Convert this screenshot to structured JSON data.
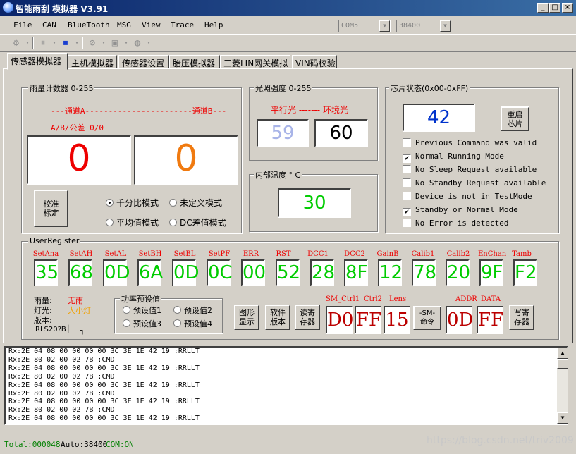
{
  "window": {
    "title": "智能雨刮 模拟器 V3.91",
    "minimize": "_",
    "maximize": "□",
    "close": "×"
  },
  "menu": [
    "File",
    "CAN",
    "BlueTooth",
    "MSG",
    "View",
    "Trace",
    "Help"
  ],
  "combo_port": "COM5",
  "combo_baud": "38400",
  "tabs": [
    "传感器模拟器",
    "主机模拟器",
    "传感器设置",
    "胎压模拟器",
    "三菱LIN网关模拟",
    "VIN码校验"
  ],
  "rain": {
    "title": "雨量计数器 0-255",
    "channels": "---通道A-----------------------通道B---",
    "ab_label": "A/B/公差  0/0",
    "value_a": "0",
    "value_b": "0",
    "calib_button": "校准\n标定",
    "modes": [
      {
        "label": "千分比模式",
        "checked": true
      },
      {
        "label": "未定义模式",
        "checked": false
      },
      {
        "label": "平均值模式",
        "checked": false
      },
      {
        "label": "DC差值模式",
        "checked": false
      }
    ]
  },
  "light": {
    "title": "光照强度 0-255",
    "subtitle": "平行光 ------- 环境光",
    "parallel": "59",
    "ambient": "60"
  },
  "temp": {
    "title": "内部温度 ° C",
    "value": "30"
  },
  "chip": {
    "title": "芯片状态(0x00-0xFF)",
    "value": "42",
    "restart_button": "重启\n芯片",
    "flags": [
      {
        "label": "Previous Command was valid",
        "checked": false
      },
      {
        "label": "Normal Running Mode",
        "checked": true
      },
      {
        "label": "No Sleep Request available",
        "checked": false
      },
      {
        "label": "No Standby Request available",
        "checked": false
      },
      {
        "label": "Device is not in TestMode",
        "checked": false
      },
      {
        "label": "Standby or Normal Mode",
        "checked": true
      },
      {
        "label": "No Error is detected",
        "checked": false
      }
    ]
  },
  "userregister": {
    "title": "UserRegister",
    "registers": [
      {
        "name": "SetAna",
        "value": "35"
      },
      {
        "name": "SetAH",
        "value": "68"
      },
      {
        "name": "SetAL",
        "value": "0D"
      },
      {
        "name": "SetBH",
        "value": "6A"
      },
      {
        "name": "SetBL",
        "value": "0D"
      },
      {
        "name": "SetPF",
        "value": "0C"
      },
      {
        "name": "ERR",
        "value": "00"
      },
      {
        "name": "RST",
        "value": "52"
      },
      {
        "name": "DCC1",
        "value": "28"
      },
      {
        "name": "DCC2",
        "value": "8F"
      },
      {
        "name": "GainB",
        "value": "12"
      },
      {
        "name": "Calib1",
        "value": "78"
      },
      {
        "name": "Calib2",
        "value": "20"
      },
      {
        "name": "EnChan",
        "value": "9F"
      },
      {
        "name": "Tamb",
        "value": "F2"
      }
    ],
    "rain_label": "雨量:",
    "rain_value": "无雨",
    "light_label": "灯光:",
    "light_value": "大小灯",
    "version_label": "版本:",
    "rls_label": "RLS20?B┤",
    "rls_extra": "┐",
    "power_title": "功率预设值",
    "presets": [
      "预设值1",
      "预设值2",
      "预设值3",
      "预设值4"
    ],
    "graph_button": "图形\n显示",
    "softver_button": "软件\n版本",
    "readreg_button": "读寄\n存器",
    "sm_ctrl1_label": "SM_Ctrl1",
    "sm_ctrl1": "D0",
    "ctrl2_label": "Ctrl2",
    "ctrl2": "FF",
    "lens_label": "Lens",
    "lens": "15",
    "sm_cmd_button": "-SM-\n命令",
    "addr_label": "ADDR",
    "addr": "0D",
    "data_label": "DATA",
    "data": "FF",
    "writereg_button": "写寄\n存器"
  },
  "log": [
    "Rx:2E 04 08 00 00 00 00 3C 3E 1E 42 19  :RRLLT",
    "Rx:2E 80 02 00 02 7B  :CMD",
    "Rx:2E 04 08 00 00 00 00 3C 3E 1E 42 19  :RRLLT",
    "Rx:2E 80 02 00 02 7B  :CMD",
    "Rx:2E 04 08 00 00 00 00 3C 3E 1E 42 19  :RRLLT",
    "Rx:2E 80 02 00 02 7B  :CMD",
    "Rx:2E 04 08 00 00 00 00 3C 3E 1E 42 19  :RRLLT",
    "Rx:2E 80 02 00 02 7B  :CMD",
    "Rx:2E 04 08 00 00 00 00 3C 3E 1E 42 19  :RRLLT"
  ],
  "status": {
    "total": "Total:000048",
    "auto": "Auto:38400",
    "com": "COM:ON"
  },
  "watermark": "https://blog.csdn.net/triv2009"
}
